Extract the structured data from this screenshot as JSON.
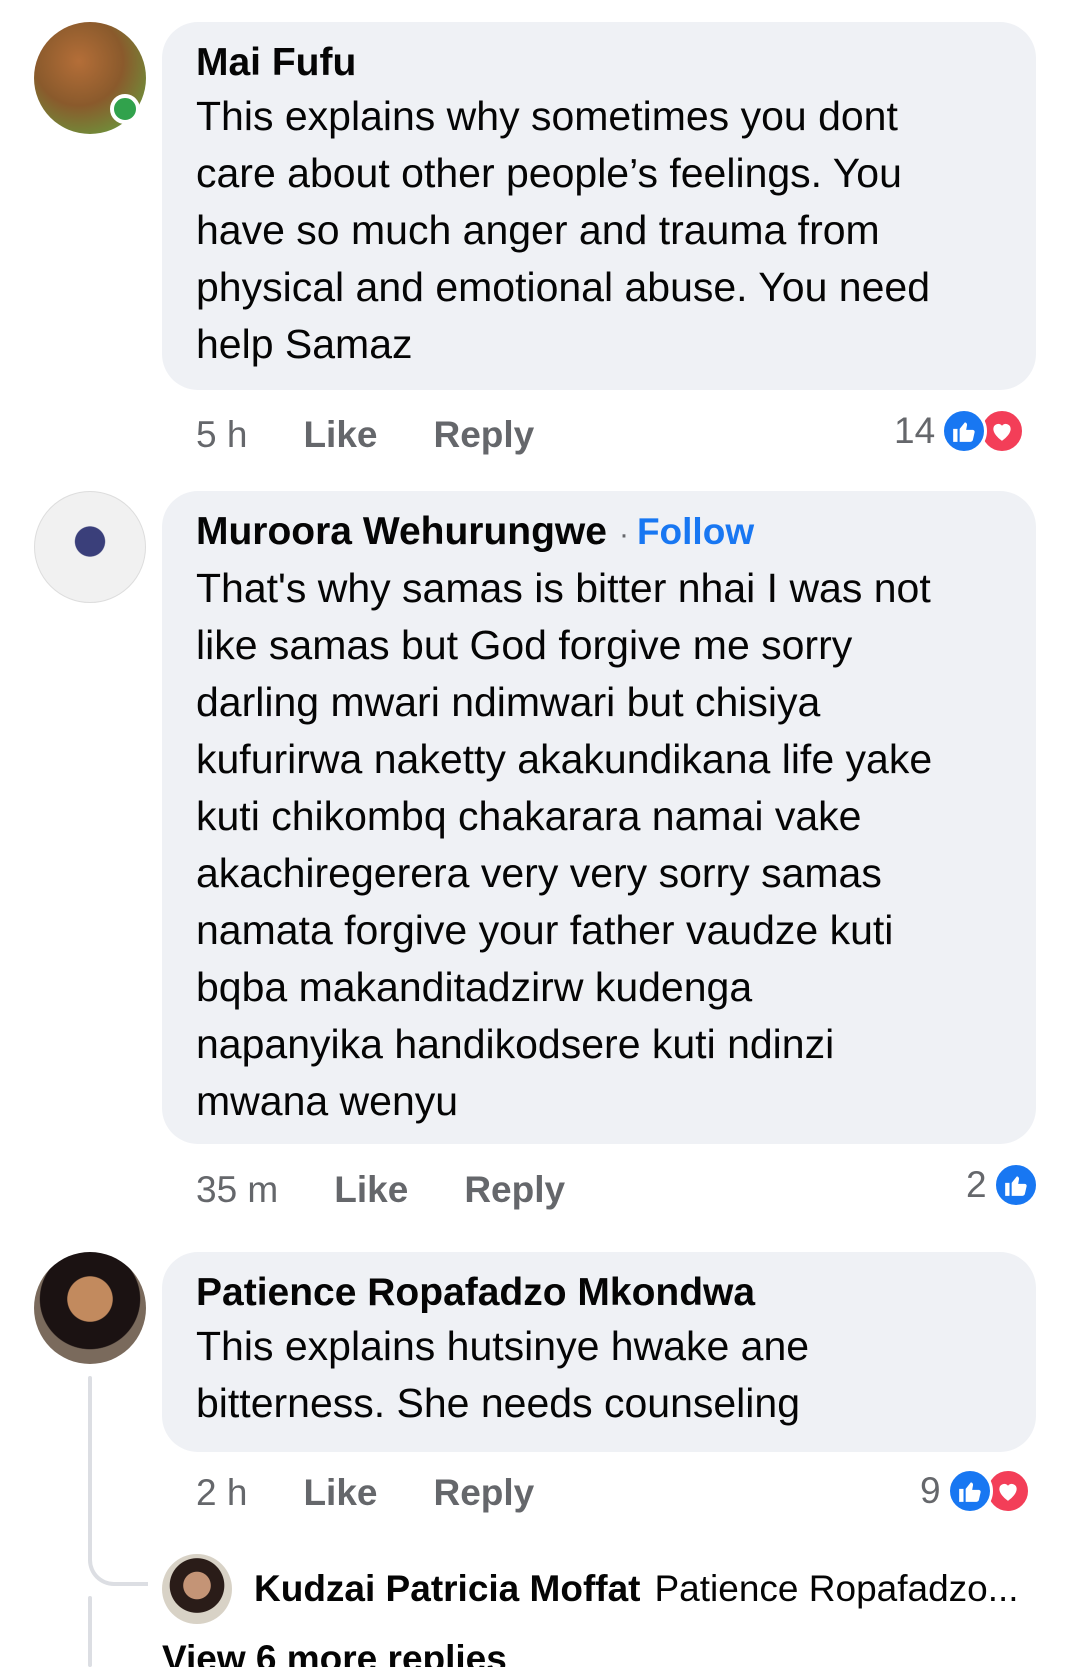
{
  "comments": [
    {
      "author": "Mai Fufu",
      "text": "This explains why sometimes you dont\ncare about other people’s feelings. You\nhave so much anger and trauma from\nphysical and emotional abuse. You need\nhelp Samaz",
      "time": "5 h",
      "like_label": "Like",
      "reply_label": "Reply",
      "reaction_count": "14",
      "reactions": [
        "like-icon",
        "love-icon"
      ],
      "online": true
    },
    {
      "author": "Muroora Wehurungwe",
      "separator": "·",
      "follow_label": "Follow",
      "text": "That's why samas is bitter nhai I was not\nlike samas but God forgive me sorry\ndarling mwari ndimwari but chisiya\nkufurirwa naketty akakundikana life yake\nkuti chikombq chakarara namai vake\nakachiregerera very very sorry samas\nnamata forgive your father vaudze kuti\nbqba makanditadzirw kudenga\nnapanyika handikodsere kuti ndinzi\nmwana wenyu",
      "time": "35 m",
      "like_label": "Like",
      "reply_label": "Reply",
      "reaction_count": "2",
      "reactions": [
        "like-icon"
      ]
    },
    {
      "author": "Patience Ropafadzo Mkondwa",
      "text": "This explains hutsinye hwake ane\nbitterness. She needs counseling",
      "time": "2 h",
      "like_label": "Like",
      "reply_label": "Reply",
      "reaction_count": "9",
      "reactions": [
        "like-icon",
        "love-icon"
      ],
      "reply_preview": {
        "author": "Kudzai Patricia Moffat",
        "snippet": "Patience Ropafadzo..."
      },
      "view_more": "View 6 more replies"
    }
  ],
  "colors": {
    "bubble": "#eff1f5",
    "meta_text": "#65676b",
    "link_blue": "#1877f2",
    "love_red": "#f33e58",
    "online_green": "#31a24c"
  }
}
